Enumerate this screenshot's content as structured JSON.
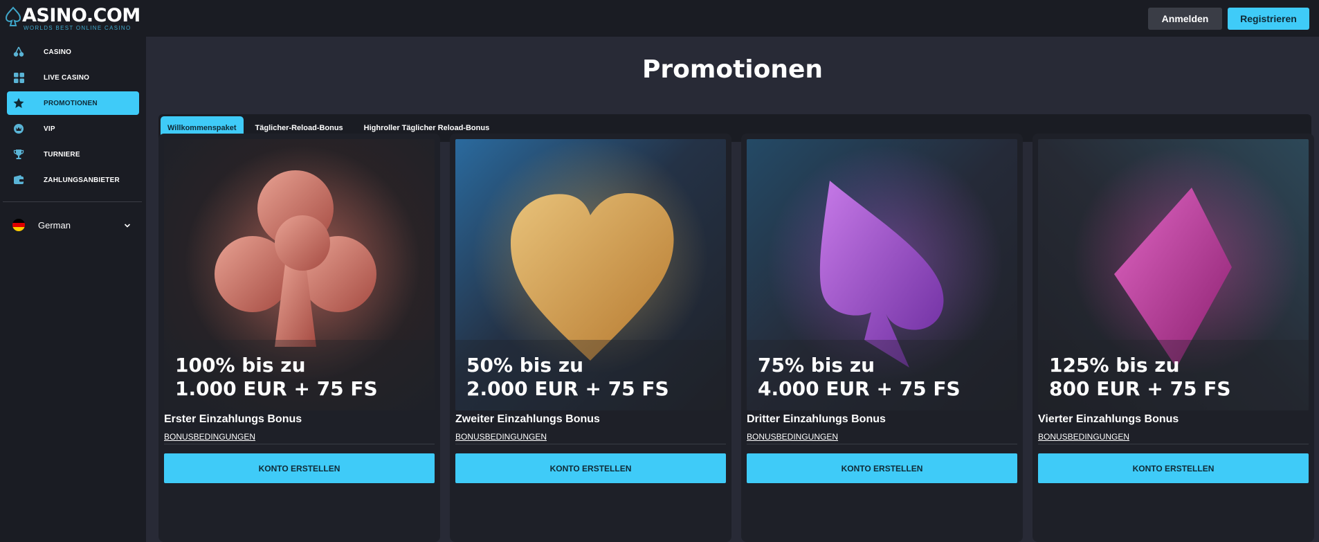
{
  "brand": {
    "name": "ASINO.COM",
    "tagline": "WORLDS BEST ONLINE CASINO",
    "accent": "#3fcbf8"
  },
  "header": {
    "login_label": "Anmelden",
    "register_label": "Registrieren"
  },
  "sidebar": {
    "items": [
      {
        "label": "CASINO",
        "icon": "cherries-icon"
      },
      {
        "label": "LIVE CASINO",
        "icon": "grid-icon"
      },
      {
        "label": "PROMOTIONEN",
        "icon": "star-icon",
        "active": true
      },
      {
        "label": "VIP",
        "icon": "crown-icon"
      },
      {
        "label": "TURNIERE",
        "icon": "trophy-icon"
      },
      {
        "label": "ZAHLUNGSANBIETER",
        "icon": "wallet-icon"
      }
    ],
    "language": {
      "label": "German",
      "icon": "german-flag-icon"
    }
  },
  "main": {
    "title": "Promotionen",
    "tabs": [
      {
        "label": "Willkommenspaket",
        "active": true
      },
      {
        "label": "Täglicher-Reload-Bonus"
      },
      {
        "label": "Highroller Täglicher Reload-Bonus"
      }
    ],
    "cards": [
      {
        "offer_line1": "100% bis zu",
        "offer_line2": "1.000 EUR + 75 FS",
        "title": "Erster Einzahlungs Bonus",
        "link": "BONUSBEDINGUNGEN",
        "button": "KONTO ERSTELLEN",
        "icon": "club-suit-icon"
      },
      {
        "offer_line1": "50% bis zu",
        "offer_line2": "2.000 EUR + 75 FS",
        "title": "Zweiter Einzahlungs Bonus",
        "link": "BONUSBEDINGUNGEN",
        "button": "KONTO ERSTELLEN",
        "icon": "heart-suit-icon"
      },
      {
        "offer_line1": "75% bis zu",
        "offer_line2": "4.000 EUR + 75 FS",
        "title": "Dritter Einzahlungs Bonus",
        "link": "BONUSBEDINGUNGEN",
        "button": "KONTO ERSTELLEN",
        "icon": "spade-suit-icon"
      },
      {
        "offer_line1": "125% bis zu",
        "offer_line2": "800 EUR + 75 FS",
        "title": "Vierter Einzahlungs Bonus",
        "link": "BONUSBEDINGUNGEN",
        "button": "KONTO ERSTELLEN",
        "icon": "diamond-suit-icon"
      }
    ]
  }
}
